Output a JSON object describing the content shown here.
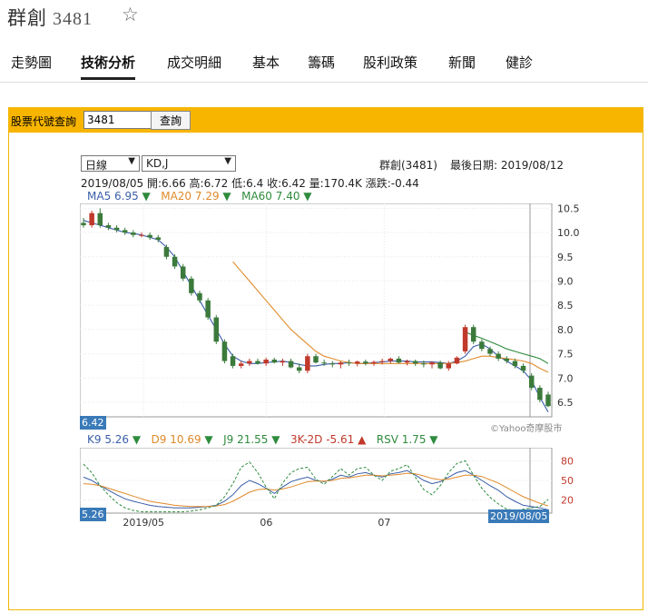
{
  "stock": {
    "name": "群創",
    "code": "3481"
  },
  "nav": {
    "tabs": [
      "走勢圖",
      "技術分析",
      "成交明細",
      "基本",
      "籌碼",
      "股利政策",
      "新聞",
      "健診"
    ],
    "active": 1
  },
  "query": {
    "label": "股票代號查詢",
    "value": "3481",
    "button": "查詢"
  },
  "controls": {
    "period": "日線",
    "indicator": "KD,J"
  },
  "header": {
    "stock_label": "群創(3481)",
    "last_date_label": "最後日期: 2019/08/12"
  },
  "ohlc_line": "2019/08/05  開:6.66  高:6.72  低:6.4  收:6.42  量:170.4K  漲跌:-0.44",
  "ma_legend": [
    {
      "text": "MA5 6.95",
      "color": "#3a5ea8"
    },
    {
      "text": "MA20 7.29",
      "color": "#e08a2a"
    },
    {
      "text": "MA60 7.40",
      "color": "#2e8b3d"
    }
  ],
  "kd_legend": [
    {
      "text": "K9 5.26",
      "color": "#3a5ea8"
    },
    {
      "text": "D9 10.69",
      "color": "#e08a2a"
    },
    {
      "text": "J9 21.55",
      "color": "#2e8b3d"
    },
    {
      "text": "3K-2D -5.61",
      "color": "#c0392b"
    },
    {
      "text": "RSV 1.75",
      "color": "#2e8b3d"
    }
  ],
  "badges": {
    "price": "6.42",
    "kd": "5.26",
    "date": "2019/08/05"
  },
  "watermark": "©Yahoo奇摩股市",
  "colors": {
    "up": "#c0392b",
    "down": "#3b7a3b",
    "ma5": "#3a5ea8",
    "ma20": "#e08a2a",
    "ma60": "#2e8b3d",
    "accent": "#f7b500"
  },
  "chart_data": [
    {
      "type": "candlestick",
      "y_ticks": [
        "10.5",
        "10.0",
        "9.5",
        "9.0",
        "8.5",
        "8.0",
        "7.5",
        "7.0",
        "6.5"
      ],
      "ylim": [
        6.2,
        10.6
      ],
      "x_ticks": [
        "2019/05",
        "06",
        "07"
      ],
      "series": [
        {
          "name": "MA5",
          "values": [
            10.25,
            10.2,
            10.15,
            10.1,
            10.05,
            10.0,
            9.98,
            9.95,
            9.9,
            9.85,
            9.7,
            9.5,
            9.2,
            8.9,
            8.6,
            8.3,
            8.0,
            7.7,
            7.45,
            7.35,
            7.3,
            7.3,
            7.32,
            7.33,
            7.35,
            7.32,
            7.28,
            7.25,
            7.25,
            7.28,
            7.3,
            7.3,
            7.32,
            7.3,
            7.3,
            7.32,
            7.33,
            7.35,
            7.35,
            7.35,
            7.33,
            7.33,
            7.33,
            7.32,
            7.3,
            7.35,
            7.45,
            7.65,
            7.7,
            7.6,
            7.45,
            7.35,
            7.25,
            7.15,
            6.95,
            6.6,
            6.3
          ]
        },
        {
          "name": "MA20",
          "values": [
            null,
            null,
            null,
            null,
            null,
            null,
            null,
            null,
            null,
            null,
            null,
            null,
            null,
            null,
            null,
            null,
            null,
            null,
            9.4,
            9.2,
            9.0,
            8.8,
            8.6,
            8.4,
            8.2,
            8.0,
            7.85,
            7.7,
            7.55,
            7.45,
            7.4,
            7.35,
            7.32,
            7.3,
            7.3,
            7.3,
            7.3,
            7.3,
            7.3,
            7.3,
            7.3,
            7.3,
            7.3,
            7.3,
            7.3,
            7.32,
            7.35,
            7.4,
            7.45,
            7.45,
            7.42,
            7.4,
            7.38,
            7.35,
            7.3,
            7.2,
            7.12
          ]
        },
        {
          "name": "MA60",
          "values": [
            null,
            null,
            null,
            null,
            null,
            null,
            null,
            null,
            null,
            null,
            null,
            null,
            null,
            null,
            null,
            null,
            null,
            null,
            null,
            null,
            null,
            null,
            null,
            null,
            null,
            null,
            null,
            null,
            null,
            null,
            null,
            null,
            null,
            null,
            null,
            null,
            null,
            null,
            null,
            null,
            null,
            null,
            null,
            null,
            null,
            null,
            7.95,
            7.88,
            7.82,
            7.75,
            7.68,
            7.6,
            7.55,
            7.5,
            7.45,
            7.4,
            7.3
          ]
        }
      ],
      "candles": [
        [
          10.2,
          10.3,
          10.1,
          10.15
        ],
        [
          10.15,
          10.45,
          10.1,
          10.4
        ],
        [
          10.4,
          10.5,
          10.1,
          10.15
        ],
        [
          10.15,
          10.2,
          10.05,
          10.1
        ],
        [
          10.1,
          10.15,
          10.0,
          10.05
        ],
        [
          10.05,
          10.1,
          9.95,
          10.0
        ],
        [
          10.0,
          10.05,
          9.9,
          9.95
        ],
        [
          9.95,
          10.0,
          9.9,
          9.95
        ],
        [
          9.95,
          10.0,
          9.85,
          9.9
        ],
        [
          9.9,
          9.95,
          9.8,
          9.85
        ],
        [
          9.7,
          9.75,
          9.45,
          9.5
        ],
        [
          9.5,
          9.55,
          9.25,
          9.3
        ],
        [
          9.3,
          9.35,
          9.0,
          9.05
        ],
        [
          9.05,
          9.1,
          8.7,
          8.75
        ],
        [
          8.75,
          8.8,
          8.55,
          8.6
        ],
        [
          8.6,
          8.65,
          8.2,
          8.25
        ],
        [
          8.25,
          8.3,
          7.7,
          7.75
        ],
        [
          7.75,
          7.8,
          7.3,
          7.35
        ],
        [
          7.45,
          7.5,
          7.2,
          7.25
        ],
        [
          7.25,
          7.35,
          7.2,
          7.3
        ],
        [
          7.3,
          7.4,
          7.25,
          7.35
        ],
        [
          7.35,
          7.4,
          7.28,
          7.3
        ],
        [
          7.3,
          7.42,
          7.25,
          7.38
        ],
        [
          7.38,
          7.42,
          7.3,
          7.32
        ],
        [
          7.32,
          7.4,
          7.25,
          7.35
        ],
        [
          7.35,
          7.4,
          7.2,
          7.22
        ],
        [
          7.22,
          7.3,
          7.1,
          7.15
        ],
        [
          7.15,
          7.5,
          7.1,
          7.45
        ],
        [
          7.45,
          7.5,
          7.3,
          7.32
        ],
        [
          7.32,
          7.38,
          7.25,
          7.3
        ],
        [
          7.3,
          7.35,
          7.22,
          7.28
        ],
        [
          7.28,
          7.35,
          7.2,
          7.32
        ],
        [
          7.32,
          7.38,
          7.25,
          7.3
        ],
        [
          7.3,
          7.36,
          7.24,
          7.34
        ],
        [
          7.34,
          7.38,
          7.26,
          7.3
        ],
        [
          7.3,
          7.36,
          7.25,
          7.33
        ],
        [
          7.33,
          7.4,
          7.28,
          7.35
        ],
        [
          7.35,
          7.42,
          7.3,
          7.4
        ],
        [
          7.4,
          7.45,
          7.3,
          7.32
        ],
        [
          7.32,
          7.38,
          7.26,
          7.35
        ],
        [
          7.35,
          7.38,
          7.25,
          7.3
        ],
        [
          7.3,
          7.36,
          7.22,
          7.28
        ],
        [
          7.28,
          7.35,
          7.2,
          7.32
        ],
        [
          7.32,
          7.36,
          7.18,
          7.2
        ],
        [
          7.2,
          7.35,
          7.15,
          7.3
        ],
        [
          7.3,
          7.45,
          7.28,
          7.42
        ],
        [
          7.55,
          8.1,
          7.5,
          8.05
        ],
        [
          8.05,
          8.1,
          7.7,
          7.75
        ],
        [
          7.75,
          7.8,
          7.55,
          7.6
        ],
        [
          7.6,
          7.65,
          7.45,
          7.5
        ],
        [
          7.5,
          7.55,
          7.35,
          7.4
        ],
        [
          7.4,
          7.45,
          7.3,
          7.35
        ],
        [
          7.35,
          7.4,
          7.2,
          7.25
        ],
        [
          7.25,
          7.3,
          7.1,
          7.15
        ],
        [
          7.05,
          7.1,
          6.75,
          6.8
        ],
        [
          6.8,
          6.85,
          6.5,
          6.55
        ],
        [
          6.66,
          6.72,
          6.4,
          6.42
        ]
      ]
    },
    {
      "type": "line",
      "y_ticks": [
        "80",
        "50",
        "20"
      ],
      "ylim": [
        0,
        100
      ],
      "series": [
        {
          "name": "K9",
          "values": [
            55,
            50,
            42,
            35,
            28,
            22,
            18,
            15,
            12,
            10,
            9,
            8,
            8,
            8,
            9,
            10,
            12,
            18,
            28,
            42,
            50,
            45,
            38,
            30,
            40,
            48,
            52,
            55,
            50,
            48,
            52,
            58,
            55,
            60,
            62,
            58,
            55,
            60,
            62,
            65,
            58,
            50,
            45,
            48,
            55,
            62,
            65,
            58,
            50,
            42,
            35,
            25,
            18,
            12,
            10,
            8,
            5
          ]
        },
        {
          "name": "D9",
          "values": [
            45,
            44,
            42,
            38,
            34,
            30,
            26,
            22,
            18,
            16,
            14,
            12,
            11,
            10,
            10,
            10,
            11,
            13,
            18,
            25,
            32,
            36,
            37,
            35,
            37,
            40,
            44,
            48,
            49,
            49,
            50,
            53,
            54,
            56,
            58,
            58,
            57,
            58,
            59,
            61,
            60,
            57,
            53,
            51,
            52,
            55,
            58,
            58,
            56,
            51,
            46,
            39,
            32,
            25,
            20,
            15,
            11
          ]
        },
        {
          "name": "J9",
          "values": [
            75,
            62,
            42,
            28,
            16,
            8,
            4,
            2,
            2,
            2,
            2,
            2,
            2,
            3,
            5,
            8,
            12,
            25,
            45,
            70,
            78,
            62,
            40,
            22,
            46,
            62,
            68,
            70,
            52,
            44,
            56,
            68,
            58,
            68,
            70,
            58,
            50,
            64,
            68,
            74,
            55,
            36,
            28,
            42,
            62,
            76,
            80,
            58,
            38,
            24,
            14,
            6,
            4,
            6,
            8,
            10,
            21
          ]
        }
      ]
    }
  ]
}
